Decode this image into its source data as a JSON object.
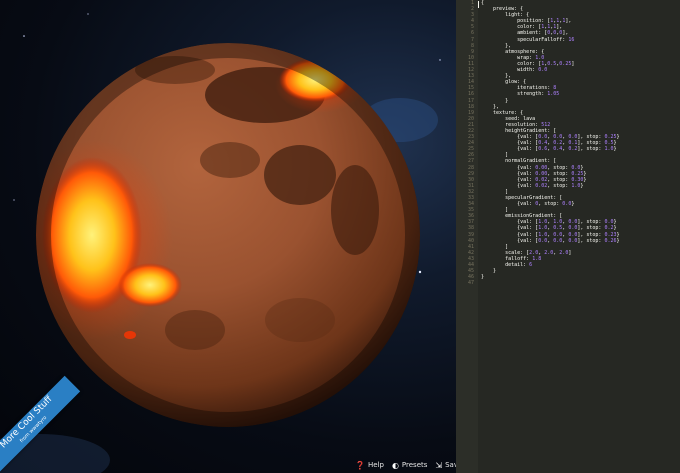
{
  "editor": {
    "lines": [
      {
        "n": "1",
        "t": "{"
      },
      {
        "n": "2",
        "t": "    preview: {"
      },
      {
        "n": "3",
        "t": "        light: {"
      },
      {
        "n": "4",
        "t": "            position: [1,1,1],"
      },
      {
        "n": "5",
        "t": "            color: [1,1,1],"
      },
      {
        "n": "6",
        "t": "            ambient: [0,0,0],"
      },
      {
        "n": "7",
        "t": "            specularFalloff: 16"
      },
      {
        "n": "8",
        "t": "        },"
      },
      {
        "n": "9",
        "t": "        atmosphere: {"
      },
      {
        "n": "10",
        "t": "            wrap: 1.0"
      },
      {
        "n": "11",
        "t": "            color: [1,0.5,0.25]"
      },
      {
        "n": "12",
        "t": "            width: 0.0"
      },
      {
        "n": "13",
        "t": "        },"
      },
      {
        "n": "14",
        "t": "        glow: {"
      },
      {
        "n": "15",
        "t": "            iterations: 8"
      },
      {
        "n": "16",
        "t": "            strength: 1.05"
      },
      {
        "n": "17",
        "t": "        }"
      },
      {
        "n": "18",
        "t": "    },"
      },
      {
        "n": "19",
        "t": "    texture: {"
      },
      {
        "n": "20",
        "t": "        seed: lava"
      },
      {
        "n": "21",
        "t": "        resolution: 512"
      },
      {
        "n": "22",
        "t": "        heightGradient: ["
      },
      {
        "n": "23",
        "t": "            {val: [0.0, 0.0, 0.0], stop: 0.25}"
      },
      {
        "n": "24",
        "t": "            {val: [0.4, 0.2, 0.1], stop: 0.5}"
      },
      {
        "n": "25",
        "t": "            {val: [0.6, 0.4, 0.2], stop: 1.0}"
      },
      {
        "n": "26",
        "t": "        ]"
      },
      {
        "n": "27",
        "t": "        normalGradient: ["
      },
      {
        "n": "28",
        "t": "            {val: 0.00, stop: 0.0}"
      },
      {
        "n": "29",
        "t": "            {val: 0.00, stop: 0.25}"
      },
      {
        "n": "30",
        "t": "            {val: 0.02, stop: 0.30}"
      },
      {
        "n": "31",
        "t": "            {val: 0.02, stop: 1.0}"
      },
      {
        "n": "32",
        "t": "        ]"
      },
      {
        "n": "33",
        "t": "        specularGradient: ["
      },
      {
        "n": "34",
        "t": "            {val: 0, stop: 0.0}"
      },
      {
        "n": "35",
        "t": "        ]"
      },
      {
        "n": "36",
        "t": "        emissionGradient: ["
      },
      {
        "n": "37",
        "t": "            {val: [1.0, 1.0, 0.0], stop: 0.0}"
      },
      {
        "n": "38",
        "t": "            {val: [1.0, 0.5, 0.0], stop: 0.2}"
      },
      {
        "n": "39",
        "t": "            {val: [1.0, 0.0, 0.0], stop: 0.23}"
      },
      {
        "n": "40",
        "t": "            {val: [0.0, 0.0, 0.0], stop: 0.26}"
      },
      {
        "n": "41",
        "t": "        ]"
      },
      {
        "n": "42",
        "t": "        scale: [2.0, 2.0, 2.0]"
      },
      {
        "n": "43",
        "t": "        falloff: 1.8"
      },
      {
        "n": "44",
        "t": "        detail: 6"
      },
      {
        "n": "45",
        "t": "    }"
      },
      {
        "n": "46",
        "t": "}"
      },
      {
        "n": "47",
        "t": ""
      }
    ]
  },
  "toolbar": {
    "help_label": "Help",
    "presets_label": "Presets",
    "save_label": "Save",
    "help_icon": "question-circle-icon",
    "presets_icon": "half-circle-icon",
    "save_icon": "save-arrow-icon"
  },
  "ribbon": {
    "line1": "More Cool Stuff",
    "line2": "from wwwtyro"
  },
  "colors": {
    "editor_bg": "#262823",
    "number_literal": "#ae81ff",
    "ribbon_bg": "#2a7fc4"
  }
}
